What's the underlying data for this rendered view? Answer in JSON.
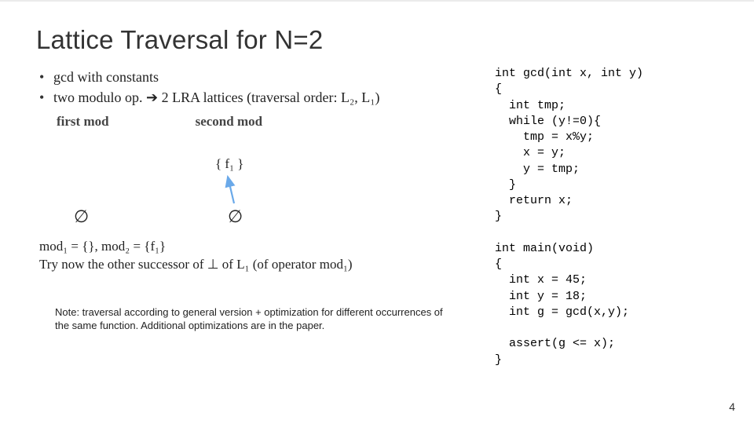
{
  "title": "Lattice Traversal for N=2",
  "bullets": [
    "gcd with constants",
    "two modulo op. ➔ 2 LRA lattices (traversal order: L₂, L₁)"
  ],
  "mod_labels": {
    "first": "first mod",
    "second": "second mod"
  },
  "diagram": {
    "f1_set": "{ f₁ }",
    "empty1": "∅",
    "empty2": "∅"
  },
  "below": {
    "line1_html": "mod₁ = {}, mod₂ = {f₁}",
    "line2_html": "Try now the other successor of ⊥ of L₁ (of operator mod₁)"
  },
  "note": "Note: traversal according to general version + optimization for different occurrences of the same function. Additional optimizations are in the paper.",
  "pagenum": "4",
  "code": "int gcd(int x, int y)\n{\n  int tmp;\n  while (y!=0){\n    tmp = x%y;\n    x = y;\n    y = tmp;\n  }\n  return x;\n}\n\nint main(void)\n{\n  int x = 45;\n  int y = 18;\n  int g = gcd(x,y);\n\n  assert(g <= x);\n}"
}
